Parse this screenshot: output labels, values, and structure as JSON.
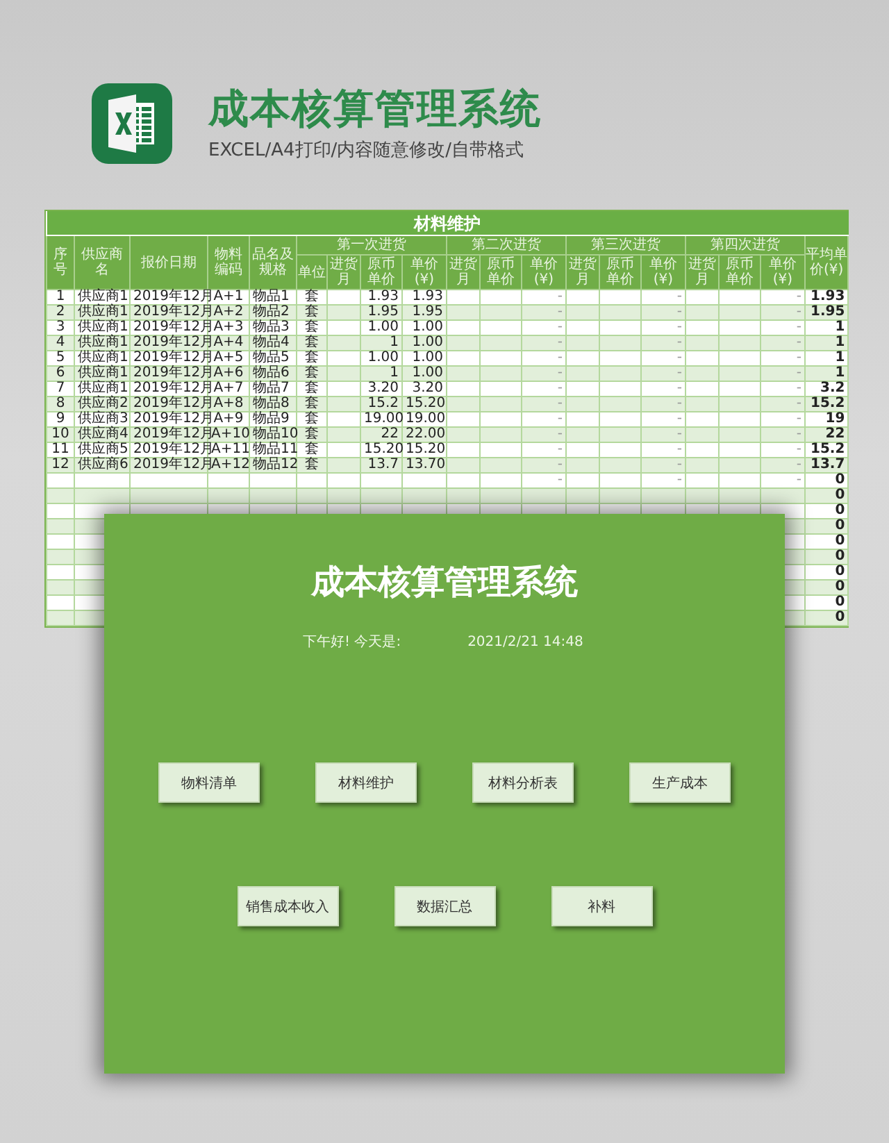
{
  "header": {
    "title": "成本核算管理系统",
    "subtitle": "EXCEL/A4打印/内容随意修改/自带格式"
  },
  "table": {
    "title": "材料维护",
    "left_columns": [
      "序号",
      "供应商名",
      "报价日期",
      "物料编码",
      "品名及规格"
    ],
    "groups": [
      {
        "label": "第一次进货",
        "columns": [
          "单位",
          "进货月",
          "原币单价",
          "单价(¥)"
        ]
      },
      {
        "label": "第二次进货",
        "columns": [
          "进货月",
          "原币单价",
          "单价(¥)"
        ]
      },
      {
        "label": "第三次进货",
        "columns": [
          "进货月",
          "原币单价",
          "单价(¥)"
        ]
      },
      {
        "label": "第四次进货",
        "columns": [
          "进货月",
          "原币单价",
          "单价(¥)"
        ]
      }
    ],
    "last_column": "平均单价(¥)",
    "rows": [
      {
        "no": "1",
        "supplier": "供应商1",
        "date": "2019年12月",
        "code": "A+1",
        "item": "物品1",
        "unit": "套",
        "orig_1": "1.93",
        "price_1": "1.93",
        "price_2": "-",
        "price_3": "-",
        "price_4": "-",
        "avg": "1.93"
      },
      {
        "no": "2",
        "supplier": "供应商1",
        "date": "2019年12月",
        "code": "A+2",
        "item": "物品2",
        "unit": "套",
        "orig_1": "1.95",
        "price_1": "1.95",
        "price_2": "-",
        "price_3": "-",
        "price_4": "-",
        "avg": "1.95"
      },
      {
        "no": "3",
        "supplier": "供应商1",
        "date": "2019年12月",
        "code": "A+3",
        "item": "物品3",
        "unit": "套",
        "orig_1": "1.00",
        "price_1": "1.00",
        "price_2": "-",
        "price_3": "-",
        "price_4": "-",
        "avg": "1"
      },
      {
        "no": "4",
        "supplier": "供应商1",
        "date": "2019年12月",
        "code": "A+4",
        "item": "物品4",
        "unit": "套",
        "orig_1": "1",
        "price_1": "1.00",
        "price_2": "-",
        "price_3": "-",
        "price_4": "-",
        "avg": "1"
      },
      {
        "no": "5",
        "supplier": "供应商1",
        "date": "2019年12月",
        "code": "A+5",
        "item": "物品5",
        "unit": "套",
        "orig_1": "1.00",
        "price_1": "1.00",
        "price_2": "-",
        "price_3": "-",
        "price_4": "-",
        "avg": "1"
      },
      {
        "no": "6",
        "supplier": "供应商1",
        "date": "2019年12月",
        "code": "A+6",
        "item": "物品6",
        "unit": "套",
        "orig_1": "1",
        "price_1": "1.00",
        "price_2": "-",
        "price_3": "-",
        "price_4": "-",
        "avg": "1"
      },
      {
        "no": "7",
        "supplier": "供应商1",
        "date": "2019年12月",
        "code": "A+7",
        "item": "物品7",
        "unit": "套",
        "orig_1": "3.20",
        "price_1": "3.20",
        "price_2": "-",
        "price_3": "-",
        "price_4": "-",
        "avg": "3.2"
      },
      {
        "no": "8",
        "supplier": "供应商2",
        "date": "2019年12月",
        "code": "A+8",
        "item": "物品8",
        "unit": "套",
        "orig_1": "15.2",
        "price_1": "15.20",
        "price_2": "-",
        "price_3": "-",
        "price_4": "-",
        "avg": "15.2"
      },
      {
        "no": "9",
        "supplier": "供应商3",
        "date": "2019年12月",
        "code": "A+9",
        "item": "物品9",
        "unit": "套",
        "orig_1": "19.00",
        "price_1": "19.00",
        "price_2": "-",
        "price_3": "-",
        "price_4": "-",
        "avg": "19"
      },
      {
        "no": "10",
        "supplier": "供应商4",
        "date": "2019年12月",
        "code": "A+10",
        "item": "物品10",
        "unit": "套",
        "orig_1": "22",
        "price_1": "22.00",
        "price_2": "-",
        "price_3": "-",
        "price_4": "-",
        "avg": "22"
      },
      {
        "no": "11",
        "supplier": "供应商5",
        "date": "2019年12月",
        "code": "A+11",
        "item": "物品11",
        "unit": "套",
        "orig_1": "15.20",
        "price_1": "15.20",
        "price_2": "-",
        "price_3": "-",
        "price_4": "-",
        "avg": "15.2"
      },
      {
        "no": "12",
        "supplier": "供应商6",
        "date": "2019年12月",
        "code": "A+12",
        "item": "物品12",
        "unit": "套",
        "orig_1": "13.7",
        "price_1": "13.70",
        "price_2": "-",
        "price_3": "-",
        "price_4": "-",
        "avg": "13.7"
      },
      {
        "price_2": "-",
        "price_3": "-",
        "price_4": "-",
        "avg": "0"
      },
      {
        "avg": "0"
      },
      {
        "avg": "0"
      },
      {
        "avg": "0"
      },
      {
        "avg": "0"
      },
      {
        "avg": "0"
      },
      {
        "avg": "0"
      },
      {
        "avg": "0"
      },
      {
        "avg": "0"
      },
      {
        "avg": "0"
      }
    ]
  },
  "panel": {
    "title": "成本核算管理系统",
    "greeting": "下午好! 今天是:",
    "datetime": "2021/2/21 14:48",
    "button_rows": [
      [
        "物料清单",
        "材料维护",
        "材料分析表",
        "生产成本"
      ],
      [
        "销售成本收入",
        "数据汇总",
        "补料"
      ]
    ]
  }
}
